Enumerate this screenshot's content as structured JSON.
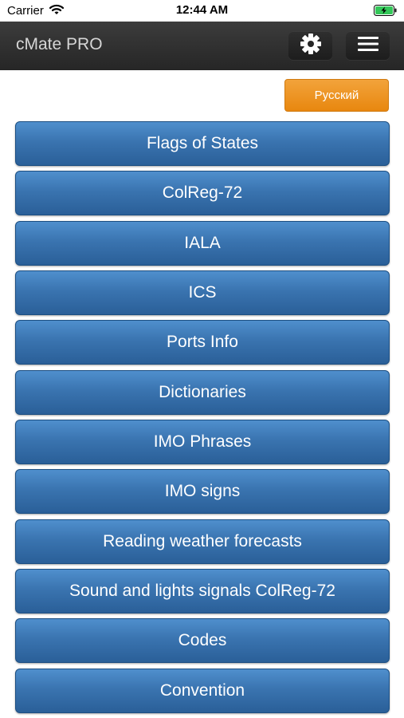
{
  "status_bar": {
    "carrier": "Carrier",
    "time": "12:44 AM",
    "icons": [
      "wifi-icon",
      "battery-charging-icon"
    ]
  },
  "navbar": {
    "title": "cMate PRO",
    "icons": [
      "gear-icon",
      "hamburger-menu-icon"
    ]
  },
  "language_button": {
    "label": "Русский",
    "color": "#ec8f1c"
  },
  "menu": {
    "button_color": "#3a74b0",
    "items": [
      {
        "label": "Flags of States"
      },
      {
        "label": "ColReg-72"
      },
      {
        "label": "IALA"
      },
      {
        "label": "ICS"
      },
      {
        "label": "Ports Info"
      },
      {
        "label": "Dictionaries"
      },
      {
        "label": "IMO Phrases"
      },
      {
        "label": "IMO signs"
      },
      {
        "label": "Reading weather forecasts"
      },
      {
        "label": "Sound and lights signals ColReg-72"
      },
      {
        "label": "Codes"
      },
      {
        "label": "Convention"
      }
    ]
  }
}
